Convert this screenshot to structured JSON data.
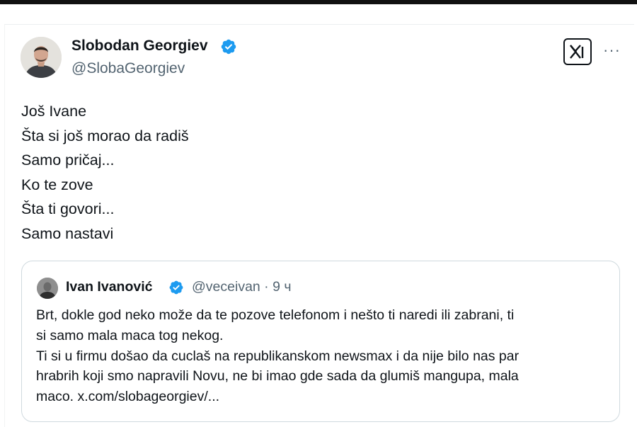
{
  "post": {
    "author": {
      "name": "Slobodan Georgiev",
      "handle": "@SlobaGeorgiev",
      "verified": true
    },
    "icons": {
      "x_logo": "x-logo-icon",
      "more": "more-options-icon"
    },
    "more_glyph": "···",
    "lines": [
      "Još Ivane",
      "Šta si još morao da radiš",
      "Samo pričaj...",
      "Ko te zove",
      "Šta ti govori...",
      "Samo nastavi"
    ]
  },
  "quoted_post": {
    "author": {
      "name": "Ivan Ivanović",
      "handle": "@veceivan · 9 ч",
      "verified": true
    },
    "lines": [
      "Brt, dokle god neko može da te pozove telefonom i nešto ti naredi ili zabrani, ti",
      "si samo mala maca tog nekog.",
      "Ti si u firmu došao da cuclaš na republikanskom newsmax i da nije bilo nas par",
      "hrabrih koji smo napravili Novu, ne bi imao gde sada da glumiš mangupa, mala",
      "maco. x.com/slobageorgiev/..."
    ]
  },
  "colors": {
    "verified_blue": "#1d9bf0",
    "text": "#0f1419",
    "secondary_text": "#536471",
    "border": "#cfd9de"
  }
}
